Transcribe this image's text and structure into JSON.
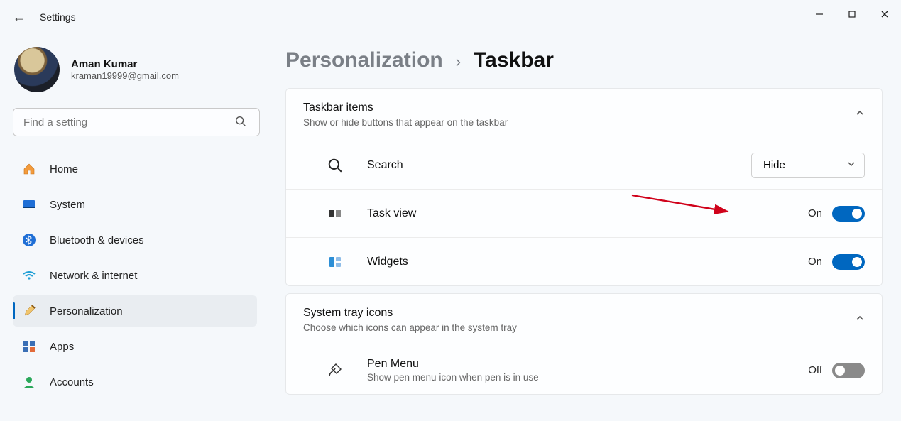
{
  "window": {
    "title": "Settings"
  },
  "user": {
    "name": "Aman Kumar",
    "email": "kraman19999@gmail.com"
  },
  "search": {
    "placeholder": "Find a setting"
  },
  "nav": [
    {
      "key": "home",
      "label": "Home"
    },
    {
      "key": "system",
      "label": "System"
    },
    {
      "key": "bluetooth",
      "label": "Bluetooth & devices"
    },
    {
      "key": "network",
      "label": "Network & internet"
    },
    {
      "key": "personalization",
      "label": "Personalization"
    },
    {
      "key": "apps",
      "label": "Apps"
    },
    {
      "key": "accounts",
      "label": "Accounts"
    }
  ],
  "breadcrumb": {
    "parent": "Personalization",
    "sep": "›",
    "current": "Taskbar"
  },
  "sections": {
    "taskbarItems": {
      "title": "Taskbar items",
      "subtitle": "Show or hide buttons that appear on the taskbar",
      "rows": {
        "search": {
          "label": "Search",
          "control": "dropdown",
          "value": "Hide"
        },
        "taskview": {
          "label": "Task view",
          "control": "toggle",
          "state": "On"
        },
        "widgets": {
          "label": "Widgets",
          "control": "toggle",
          "state": "On"
        }
      }
    },
    "tray": {
      "title": "System tray icons",
      "subtitle": "Choose which icons can appear in the system tray",
      "rows": {
        "pen": {
          "label": "Pen Menu",
          "sub": "Show pen menu icon when pen is in use",
          "control": "toggle",
          "state": "Off"
        }
      }
    }
  }
}
